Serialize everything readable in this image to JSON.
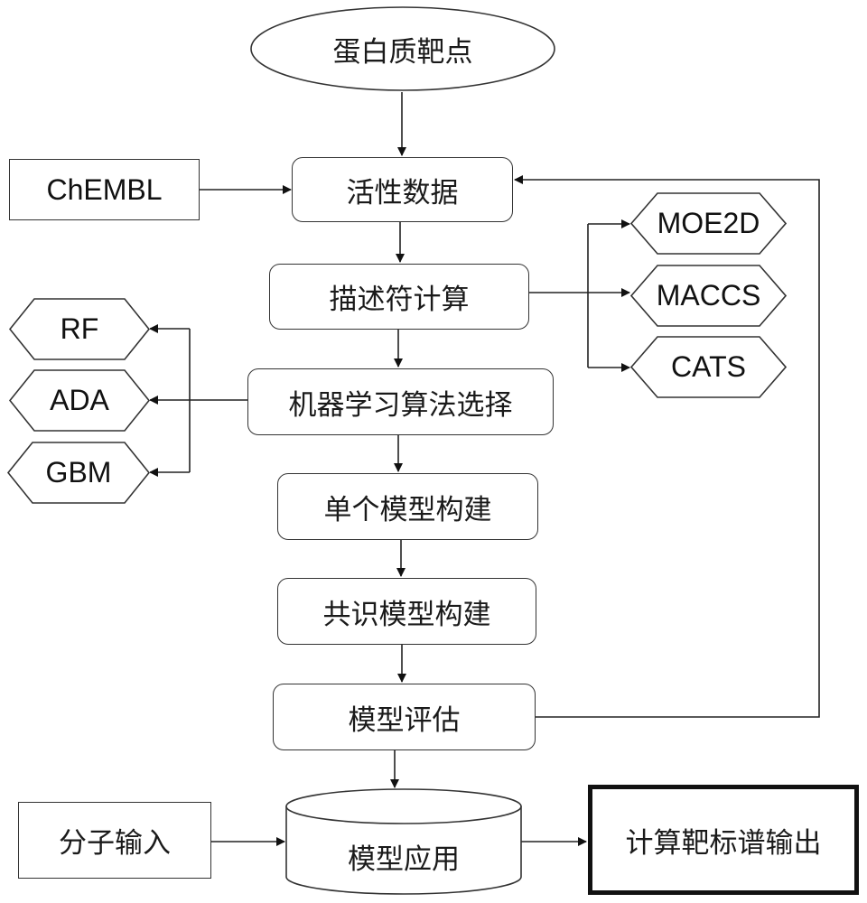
{
  "diagram": {
    "start": "蛋白质靶点",
    "source": "ChEMBL",
    "steps": {
      "activity_data": "活性数据",
      "descriptor_calc": "描述符计算",
      "ml_selection": "机器学习算法选择",
      "single_model": "单个模型构建",
      "consensus_model": "共识模型构建",
      "model_eval": "模型评估",
      "model_apply": "模型应用"
    },
    "descriptors": [
      "MOE2D",
      "MACCS",
      "CATS"
    ],
    "algorithms": [
      "RF",
      "ADA",
      "GBM"
    ],
    "molecule_input": "分子输入",
    "output": "计算靶标谱输出"
  }
}
